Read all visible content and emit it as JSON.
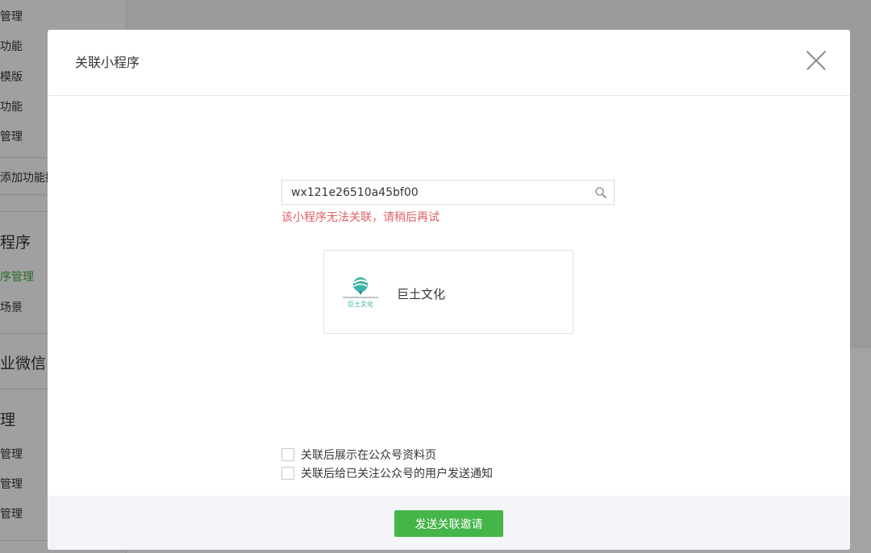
{
  "sidebar": {
    "items": [
      {
        "label": "管理"
      },
      {
        "label": "功能"
      },
      {
        "label": "模版"
      },
      {
        "label": "功能"
      },
      {
        "label": "管理"
      },
      {
        "label": "添加功能插"
      },
      {
        "label": "程序"
      },
      {
        "label": "序管理"
      },
      {
        "label": "场景"
      },
      {
        "label": "业微信"
      },
      {
        "label": "理"
      },
      {
        "label": "管理"
      },
      {
        "label": "管理"
      },
      {
        "label": "管理"
      }
    ]
  },
  "modal": {
    "title": "关联小程序",
    "search": {
      "value": "wx121e26510a45bf00",
      "placeholder": ""
    },
    "error": "该小程序无法关联，请稍后再试",
    "result": {
      "name": "巨土文化",
      "logo_text": "巨土文化"
    },
    "options": [
      {
        "label": "关联后展示在公众号资料页",
        "checked": false
      },
      {
        "label": "关联后给已关注公众号的用户发送通知",
        "checked": false
      }
    ],
    "submit_label": "发送关联邀请"
  },
  "colors": {
    "accent": "#44b549",
    "error": "#e15f63"
  }
}
